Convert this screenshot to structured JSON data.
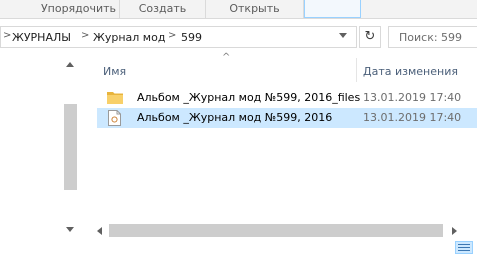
{
  "ribbon": {
    "groups": [
      "Упорядочить",
      "Создать",
      "Открыть"
    ]
  },
  "address": {
    "breadcrumbs": [
      "ЖУРНАЛЫ",
      "Журнал мод",
      "599"
    ],
    "separator": ">"
  },
  "search": {
    "placeholder": "Поиск: 599"
  },
  "columns": {
    "name": "Имя",
    "date": "Дата изменения"
  },
  "files": [
    {
      "name": "Альбом _Журнал мод №599, 2016_files",
      "date": "13.01.2019 17:40",
      "icon": "folder-icon",
      "selected": false
    },
    {
      "name": "Альбом _Журнал мод №599, 2016",
      "date": "13.01.2019 17:40",
      "icon": "html-file-icon",
      "selected": true
    }
  ],
  "colors": {
    "selection": "#cce8ff",
    "folder": "#f3c850",
    "header_text": "#4c607a"
  }
}
